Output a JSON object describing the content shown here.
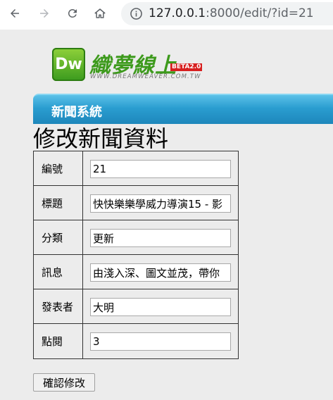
{
  "browser": {
    "url_host": "127.0.0.1",
    "url_rest": ":8000/edit/?id=21"
  },
  "logo": {
    "badge": "Dw",
    "title": "織夢線上",
    "beta": "BETA2.0",
    "subtitle": "WWW.DREAMWEAVER.COM.TW"
  },
  "header": {
    "title": "新聞系統"
  },
  "page": {
    "title": "修改新聞資料"
  },
  "form": {
    "fields": [
      {
        "label": "編號",
        "value": "21"
      },
      {
        "label": "標題",
        "value": "快快樂樂學威力導演15 - 影"
      },
      {
        "label": "分類",
        "value": "更新"
      },
      {
        "label": "訊息",
        "value": "由淺入深、圖文並茂，帶你"
      },
      {
        "label": "發表者",
        "value": "大明"
      },
      {
        "label": "點閱",
        "value": "3"
      }
    ],
    "submit_label": "確認修改"
  },
  "colors": {
    "header_bar": "#2a9dd0",
    "logo_green": "#3d9a1c",
    "beta_red": "#d71f1f"
  }
}
